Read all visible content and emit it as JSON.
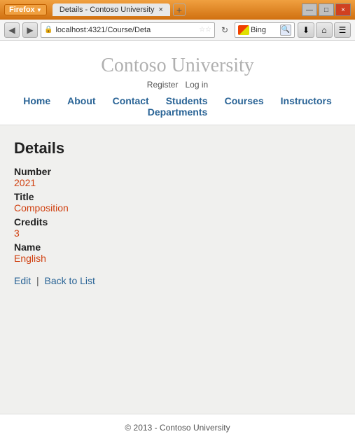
{
  "window": {
    "titlebar": {
      "browser_label": "Firefox",
      "tab_title": "Details - Contoso University",
      "tab_close": "×",
      "tab_new": "+",
      "btn_minimize": "—",
      "btn_maximize": "□",
      "btn_close": "×"
    },
    "navbar": {
      "back_icon": "◀",
      "forward_icon": "▶",
      "address": "localhost:4321/Course/Deta",
      "star1": "☆",
      "star2": "☆",
      "refresh": "↻",
      "search_placeholder": "Bing",
      "search_icon": "🔍",
      "nav_download": "⬇",
      "nav_home": "⌂",
      "nav_menu": "☰"
    }
  },
  "site": {
    "title": "Contoso University",
    "auth": {
      "register": "Register",
      "login": "Log in"
    },
    "nav": [
      {
        "label": "Home"
      },
      {
        "label": "About"
      },
      {
        "label": "Contact"
      },
      {
        "label": "Students"
      },
      {
        "label": "Courses"
      },
      {
        "label": "Instructors"
      },
      {
        "label": "Departments"
      }
    ]
  },
  "page": {
    "heading": "Details",
    "fields": [
      {
        "label": "Number",
        "value": "2021"
      },
      {
        "label": "Title",
        "value": "Composition"
      },
      {
        "label": "Credits",
        "value": "3"
      },
      {
        "label": "Name",
        "value": "English"
      }
    ],
    "actions": {
      "edit": "Edit",
      "separator": "|",
      "back": "Back to List"
    }
  },
  "footer": {
    "text": "© 2013 - Contoso University"
  }
}
